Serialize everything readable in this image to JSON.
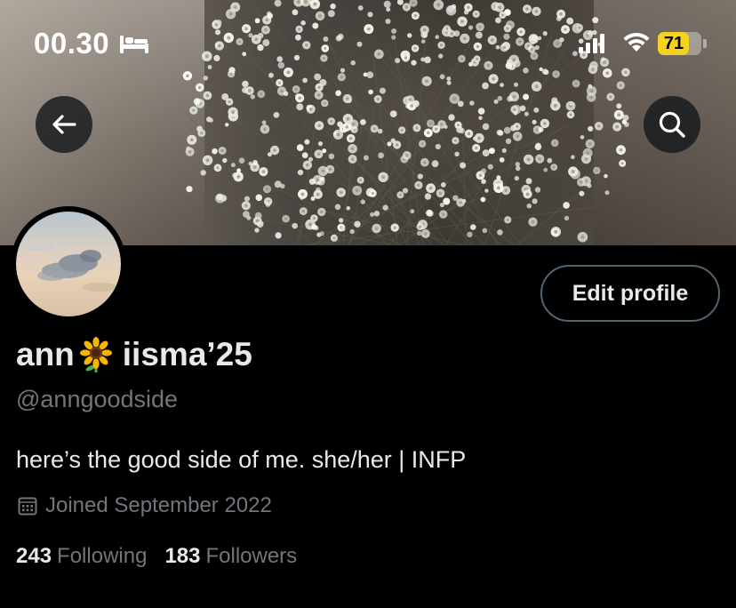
{
  "status_bar": {
    "time": "00.30",
    "sleep_icon": "bed-icon",
    "signal_icon": "cellular-signal-icon",
    "wifi_icon": "wifi-icon",
    "battery_level": "71",
    "battery_fraction": 0.71,
    "battery_color": "#f4d21f"
  },
  "header": {
    "back_icon": "arrow-left-icon",
    "search_icon": "search-icon"
  },
  "profile": {
    "display_name": "ann",
    "display_name_emoji": "sunflower",
    "display_name_suffix": "iisma’25",
    "handle": "@anngoodside",
    "bio": "here’s the good side of me. she/her | INFP",
    "joined": "Joined September 2022",
    "joined_icon": "calendar-icon",
    "edit_button_label": "Edit profile"
  },
  "stats": {
    "following_count": "243",
    "following_label": "Following",
    "followers_count": "183",
    "followers_label": "Followers"
  },
  "colors": {
    "background": "#000000",
    "primary_text": "#e7e9ea",
    "secondary_text": "#71767b",
    "button_border": "#536471"
  }
}
